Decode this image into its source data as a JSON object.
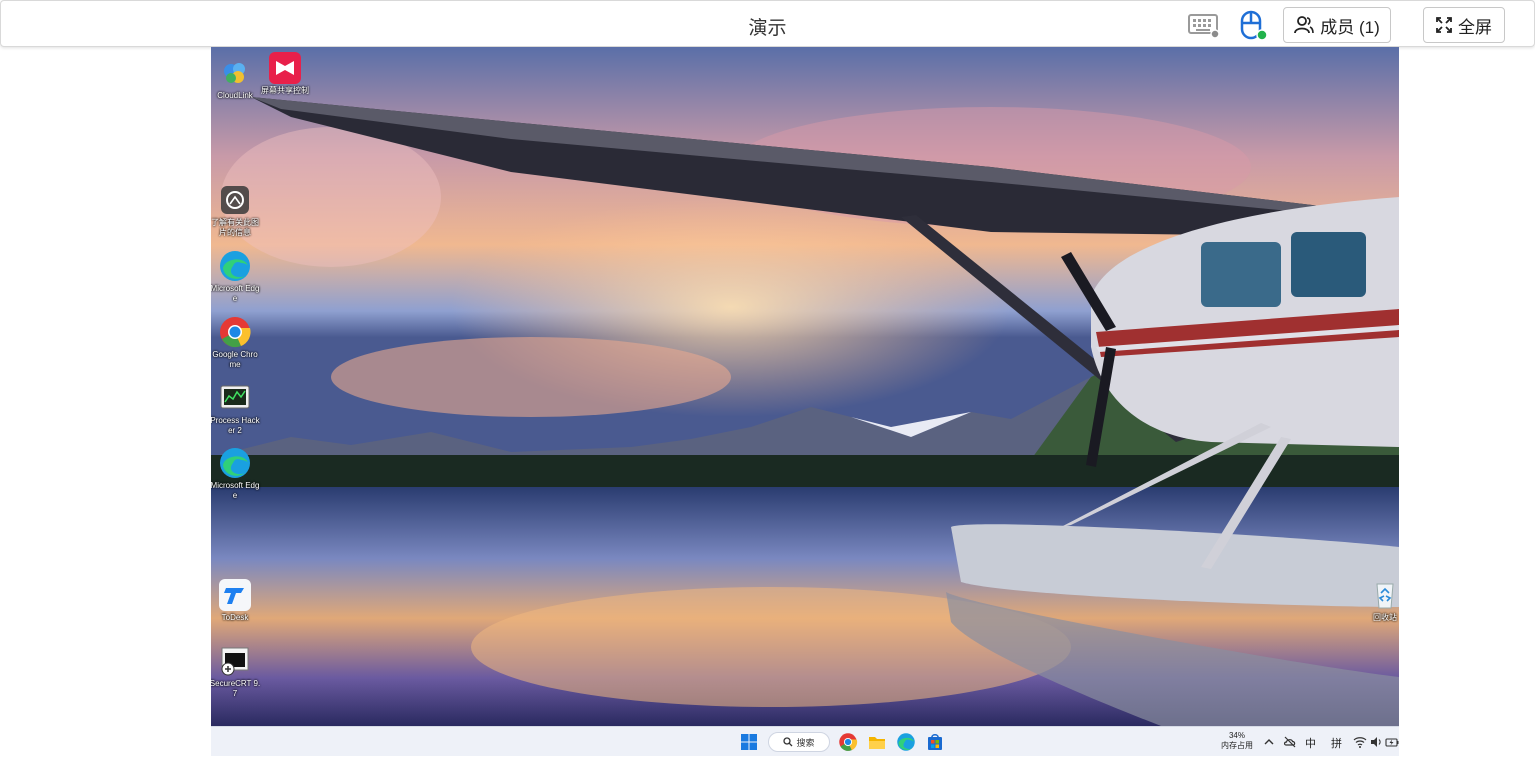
{
  "topbar": {
    "title": "演示",
    "members_label": "成员 (1)",
    "fullscreen_label": "全屏"
  },
  "desktop": {
    "icons": [
      {
        "label": "CloudLink"
      },
      {
        "label": "屏幕共享控制"
      },
      {
        "label": "了解有关此图片的信息"
      },
      {
        "label": "Microsoft Edge"
      },
      {
        "label": "Google Chrome"
      },
      {
        "label": "Process Hacker 2"
      },
      {
        "label": "Microsoft Edge"
      },
      {
        "label": "ToDesk"
      },
      {
        "label": "SecureCRT 9.7"
      },
      {
        "label": "回收站"
      }
    ]
  },
  "taskbar": {
    "search_label": "搜索",
    "memory_percent": "34%",
    "memory_label": "内存占用",
    "ime_lang": "中",
    "ime_mode": "拼"
  },
  "colors": {
    "accent_blue": "#1f6fd6",
    "online_green": "#22b24c",
    "taskbar_bg": "#eef1f8"
  }
}
